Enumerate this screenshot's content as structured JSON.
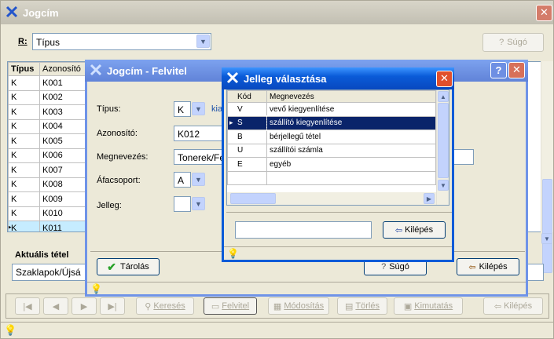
{
  "main": {
    "title": "Jogcím",
    "filter_label": "R:",
    "filter_value": "Típus",
    "help_label": "Súgó",
    "columns": [
      "Típus",
      "Azonosító"
    ],
    "rows": [
      [
        "K",
        "K001"
      ],
      [
        "K",
        "K002"
      ],
      [
        "K",
        "K003"
      ],
      [
        "K",
        "K004"
      ],
      [
        "K",
        "K005"
      ],
      [
        "K",
        "K006"
      ],
      [
        "K",
        "K007"
      ],
      [
        "K",
        "K008"
      ],
      [
        "K",
        "K009"
      ],
      [
        "K",
        "K010"
      ],
      [
        "K",
        "K011"
      ]
    ],
    "current_label": "Aktuális tétel",
    "current_value": "Szaklapok/Újsá",
    "toolbar": {
      "search": "Keresés",
      "new": "Felvitel",
      "modify": "Módosítás",
      "delete": "Törlés",
      "report": "Kimutatás",
      "exit": "Kilépés"
    }
  },
  "felvitel": {
    "title": "Jogcím - Felvitel",
    "tipus_label": "Típus:",
    "tipus_value": "K",
    "tipus_suffix": "kia",
    "azon_label": "Azonosító:",
    "azon_value": "K012",
    "megn_label": "Megnevezés:",
    "megn_value": "Tonerek/Fes",
    "afa_label": "Áfacsoport:",
    "afa_value": "A",
    "jelleg_label": "Jelleg:",
    "jelleg_value": "",
    "save_label": "Tárolás",
    "help_label": "Súgó",
    "exit_label": "Kilépés"
  },
  "jelleg": {
    "title": "Jelleg választása",
    "col_code": "Kód",
    "col_name": "Megnevezés",
    "rows": [
      {
        "code": "V",
        "name": "vevő kiegyenlítése"
      },
      {
        "code": "S",
        "name": "szállító kiegyenlítése"
      },
      {
        "code": "B",
        "name": "bérjellegű tétel"
      },
      {
        "code": "U",
        "name": "szállítói számla"
      },
      {
        "code": "E",
        "name": "egyéb"
      }
    ],
    "search_value": "",
    "exit_label": "Kilépés"
  },
  "colors": {
    "xp_blue": "#0a5bd8",
    "xp_blue_light": "#3d95ff",
    "selection": "#0a246a",
    "main_row_highlight": "#c6ecff"
  }
}
